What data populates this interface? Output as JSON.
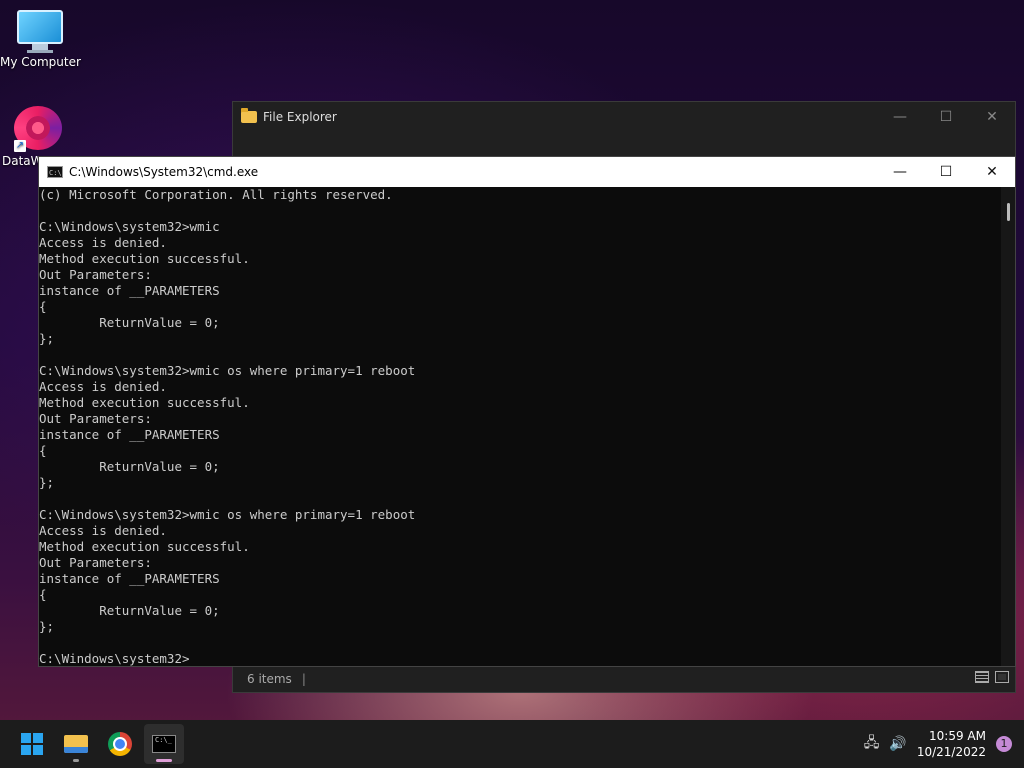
{
  "desktop": {
    "icons": [
      {
        "label": "My Computer"
      },
      {
        "label": "DataW"
      }
    ]
  },
  "file_explorer": {
    "title": "File Explorer",
    "status_items": "6 items",
    "status_sep": "|"
  },
  "cmd": {
    "title": "C:\\Windows\\System32\\cmd.exe",
    "lines": [
      "(c) Microsoft Corporation. All rights reserved.",
      "",
      "C:\\Windows\\system32>wmic",
      "Access is denied.",
      "Method execution successful.",
      "Out Parameters:",
      "instance of __PARAMETERS",
      "{",
      "        ReturnValue = 0;",
      "};",
      "",
      "C:\\Windows\\system32>wmic os where primary=1 reboot",
      "Access is denied.",
      "Method execution successful.",
      "Out Parameters:",
      "instance of __PARAMETERS",
      "{",
      "        ReturnValue = 0;",
      "};",
      "",
      "C:\\Windows\\system32>wmic os where primary=1 reboot",
      "Access is denied.",
      "Method execution successful.",
      "Out Parameters:",
      "instance of __PARAMETERS",
      "{",
      "        ReturnValue = 0;",
      "};",
      "",
      "C:\\Windows\\system32>"
    ]
  },
  "window_controls": {
    "minimize": "—",
    "maximize": "☐",
    "close": "✕"
  },
  "taskbar": {
    "items": [
      "start",
      "file-explorer",
      "chrome",
      "terminal"
    ],
    "clock_time": "10:59 AM",
    "clock_date": "10/21/2022",
    "notification_count": "1",
    "tray_network_glyph": "🖧",
    "tray_volume_glyph": "🔊"
  }
}
